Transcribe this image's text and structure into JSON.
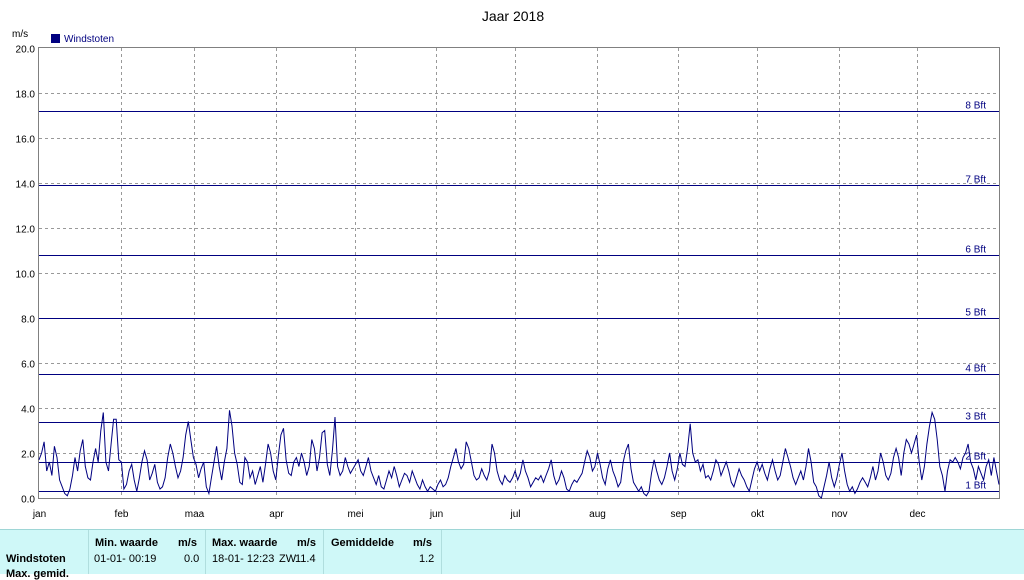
{
  "chart_data": {
    "type": "line",
    "title": "Jaar 2018",
    "ylabel": "m/s",
    "ylim": [
      0,
      20
    ],
    "yticks": [
      "0.0",
      "2.0",
      "4.0",
      "6.0",
      "8.0",
      "10.0",
      "12.0",
      "14.0",
      "16.0",
      "18.0",
      "20.0"
    ],
    "x_categories": [
      "jan",
      "feb",
      "maa",
      "apr",
      "mei",
      "jun",
      "jul",
      "aug",
      "sep",
      "okt",
      "nov",
      "dec"
    ],
    "grid": true,
    "legend_placement": "top-left",
    "series": [
      {
        "name": "Windstoten",
        "color": "#000080",
        "values": [
          1.7,
          2.0,
          2.5,
          1.2,
          1.6,
          1.0,
          2.3,
          1.8,
          0.8,
          0.5,
          0.2,
          0.1,
          0.4,
          1.0,
          1.8,
          1.2,
          2.1,
          2.6,
          1.4,
          0.9,
          0.8,
          1.6,
          2.2,
          1.6,
          3.0,
          3.8,
          1.6,
          1.2,
          2.4,
          3.5,
          3.5,
          1.7,
          1.6,
          0.4,
          0.6,
          1.2,
          1.5,
          0.8,
          0.3,
          0.9,
          1.6,
          2.1,
          1.7,
          0.8,
          1.1,
          1.5,
          0.7,
          0.4,
          0.5,
          0.9,
          1.8,
          2.4,
          2.0,
          1.4,
          0.9,
          1.2,
          1.8,
          2.8,
          3.4,
          2.6,
          1.8,
          1.5,
          0.9,
          1.3,
          1.6,
          0.5,
          0.2,
          0.9,
          1.6,
          2.3,
          1.4,
          0.8,
          1.6,
          2.2,
          3.9,
          3.2,
          2.0,
          1.5,
          0.7,
          0.6,
          1.8,
          1.6,
          0.9,
          1.2,
          0.6,
          1.0,
          1.4,
          0.7,
          1.5,
          2.4,
          2.0,
          1.2,
          0.8,
          1.9,
          2.8,
          3.1,
          1.7,
          1.1,
          1.0,
          1.6,
          1.8,
          1.4,
          2.0,
          1.6,
          1.0,
          1.4,
          2.6,
          2.2,
          1.2,
          1.8,
          2.9,
          3.0,
          1.5,
          1.0,
          2.1,
          3.6,
          1.4,
          1.0,
          1.2,
          1.8,
          1.4,
          1.1,
          1.3,
          1.5,
          1.7,
          1.2,
          1.0,
          1.4,
          1.8,
          1.2,
          0.9,
          0.6,
          1.0,
          0.5,
          0.4,
          0.8,
          1.2,
          0.9,
          1.4,
          1.0,
          0.5,
          0.8,
          1.1,
          1.0,
          0.7,
          1.2,
          0.9,
          0.6,
          0.4,
          0.8,
          0.5,
          0.3,
          0.5,
          0.4,
          0.3,
          0.6,
          0.8,
          0.5,
          0.6,
          0.9,
          1.4,
          1.8,
          2.2,
          1.6,
          1.3,
          1.5,
          2.5,
          2.2,
          1.6,
          1.0,
          0.8,
          0.9,
          1.3,
          1.0,
          0.8,
          1.2,
          2.4,
          2.0,
          1.2,
          0.8,
          0.6,
          1.0,
          0.8,
          0.7,
          0.9,
          1.2,
          0.8,
          1.1,
          1.7,
          1.2,
          0.9,
          0.5,
          0.7,
          0.9,
          0.8,
          1.0,
          0.7,
          1.0,
          1.3,
          1.7,
          1.0,
          0.6,
          0.8,
          1.2,
          0.9,
          0.4,
          0.3,
          0.6,
          0.8,
          0.7,
          0.9,
          1.1,
          1.6,
          2.1,
          1.8,
          1.2,
          1.4,
          2.0,
          1.5,
          0.9,
          0.6,
          1.3,
          1.7,
          1.2,
          0.9,
          0.5,
          0.7,
          1.6,
          2.1,
          2.4,
          1.3,
          0.7,
          0.5,
          0.3,
          0.5,
          0.2,
          0.1,
          0.3,
          1.1,
          1.7,
          1.2,
          0.8,
          0.6,
          0.9,
          1.4,
          2.0,
          1.2,
          0.8,
          1.3,
          2.0,
          1.5,
          1.4,
          2.2,
          3.3,
          2.0,
          1.6,
          1.7,
          1.2,
          1.5,
          0.9,
          1.0,
          0.8,
          1.2,
          1.7,
          1.5,
          1.0,
          1.3,
          1.6,
          1.2,
          0.7,
          0.5,
          0.9,
          1.3,
          1.0,
          0.8,
          0.5,
          0.3,
          0.8,
          1.3,
          1.6,
          1.2,
          1.5,
          1.1,
          0.8,
          1.3,
          1.7,
          1.2,
          0.8,
          1.0,
          1.6,
          2.2,
          1.8,
          1.4,
          0.9,
          0.6,
          0.9,
          1.2,
          0.8,
          1.4,
          2.2,
          1.6,
          0.7,
          0.5,
          0.1,
          0.0,
          0.5,
          1.0,
          1.6,
          0.9,
          0.5,
          0.9,
          1.5,
          2.0,
          1.2,
          0.6,
          0.3,
          0.5,
          0.2,
          0.4,
          0.7,
          0.9,
          0.7,
          0.5,
          0.9,
          1.4,
          0.8,
          1.2,
          2.0,
          1.6,
          1.0,
          0.8,
          1.1,
          1.8,
          2.2,
          1.8,
          1.0,
          2.0,
          2.6,
          2.4,
          2.0,
          2.4,
          2.8,
          1.6,
          0.8,
          1.4,
          2.4,
          3.2,
          3.8,
          3.5,
          2.6,
          1.4,
          1.0,
          0.3,
          1.2,
          1.7,
          1.6,
          1.8,
          1.6,
          1.3,
          1.8,
          2.0,
          2.4,
          1.6,
          1.3,
          0.8,
          1.4,
          1.1,
          0.8,
          1.4,
          1.7,
          1.0,
          1.8,
          1.2,
          0.6
        ]
      }
    ],
    "reference_lines": [
      {
        "label": "1 Bft",
        "value": 0.3
      },
      {
        "label": "2 Bft",
        "value": 1.6
      },
      {
        "label": "3 Bft",
        "value": 3.4
      },
      {
        "label": "4 Bft",
        "value": 5.5
      },
      {
        "label": "5 Bft",
        "value": 8.0
      },
      {
        "label": "6 Bft",
        "value": 10.8
      },
      {
        "label": "7 Bft",
        "value": 13.9
      },
      {
        "label": "8 Bft",
        "value": 17.2
      }
    ]
  },
  "stats": {
    "row1_label": "Windstoten",
    "row2_label": "Max. gemid.",
    "min_header": "Min. waarde",
    "min_unit": "m/s",
    "min_date": "01-01- 00:19",
    "min_value": "0.0",
    "max_header": "Max. waarde",
    "max_unit": "m/s",
    "max_date": "18-01- 12:23",
    "max_dir": "ZW",
    "max_value": "11.4",
    "avg_header": "Gemiddelde",
    "avg_unit": "m/s",
    "avg_value": "1.2"
  }
}
